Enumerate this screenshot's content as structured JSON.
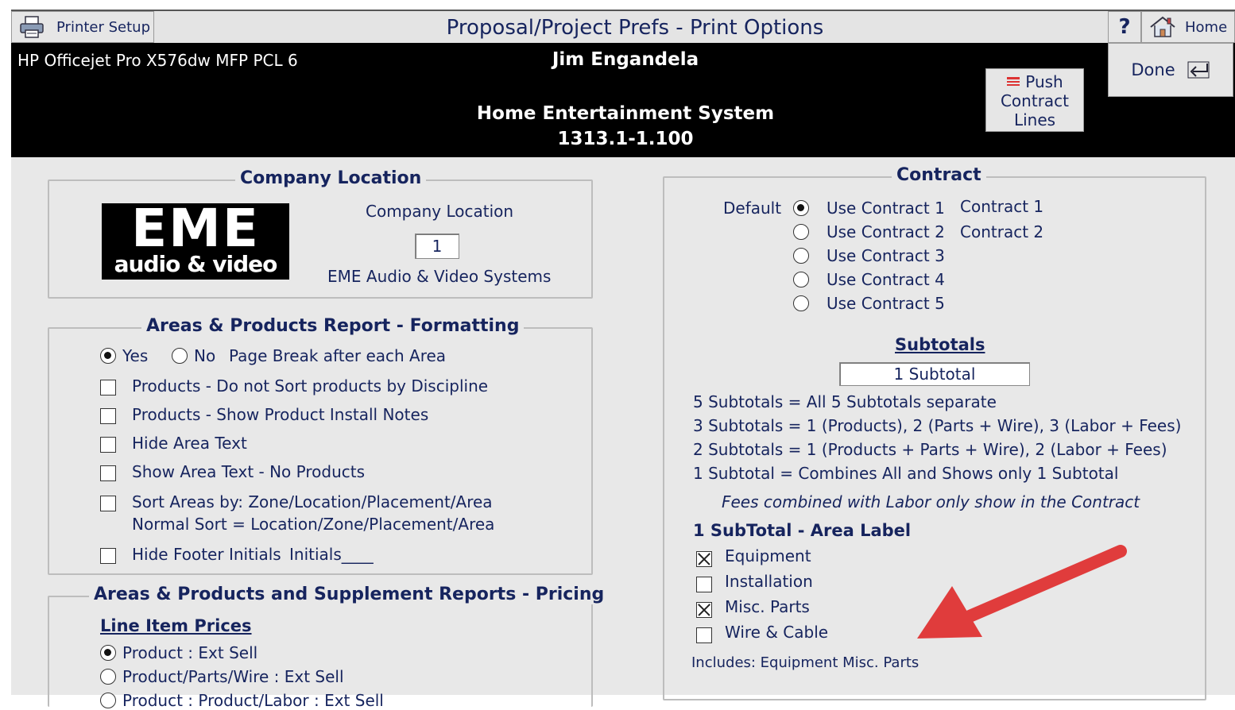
{
  "toolbar": {
    "printer_setup_label": "Printer Setup",
    "title": "Proposal/Project Prefs - Print Options",
    "help_label": "?",
    "home_label": "Home"
  },
  "header": {
    "printer_name": "HP Officejet Pro X576dw MFP PCL 6",
    "client_name": "Jim Engandela",
    "project_name": "Home Entertainment System",
    "project_number": "1313.1-1.100",
    "push_button_lines": [
      "Push",
      "Contract",
      "Lines"
    ],
    "done_label": "Done"
  },
  "company_location": {
    "legend": "Company Location",
    "logo_text_top": "EME",
    "logo_text_bottom": "audio & video",
    "field_label": "Company Location",
    "field_value": "1",
    "company_name": "EME Audio & Video Systems"
  },
  "formatting": {
    "legend": "Areas & Products Report - Formatting",
    "yes_label": "Yes",
    "no_label": "No",
    "page_break_label": "Page Break after each Area",
    "options": [
      {
        "label": "Products - Do not Sort products by Discipline",
        "checked": false
      },
      {
        "label": "Products - Show Product Install Notes",
        "checked": false
      },
      {
        "label": "Hide Area Text",
        "checked": false
      },
      {
        "label": "Show Area Text - No Products",
        "checked": false
      },
      {
        "label": "Sort Areas by: Zone/Location/Placement/Area",
        "checked": false
      },
      {
        "label": "Hide Footer Initials",
        "checked": false
      }
    ],
    "normal_sort_note": "Normal Sort = Location/Zone/Placement/Area",
    "initials_label": "Initials____"
  },
  "pricing": {
    "legend": "Areas & Products and Supplement Reports - Pricing",
    "line_item_heading": "Line Item Prices",
    "options": [
      {
        "label": "Product : Ext Sell",
        "selected": true
      },
      {
        "label": "Product/Parts/Wire : Ext Sell",
        "selected": false
      },
      {
        "label": "Product : Product/Labor : Ext Sell",
        "selected": false
      }
    ]
  },
  "contract": {
    "legend": "Contract",
    "default_label": "Default",
    "options": [
      {
        "label": "Use Contract 1",
        "name": "Contract 1",
        "selected": true
      },
      {
        "label": "Use Contract 2",
        "name": "Contract 2",
        "selected": false
      },
      {
        "label": "Use Contract 3",
        "name": "",
        "selected": false
      },
      {
        "label": "Use Contract 4",
        "name": "",
        "selected": false
      },
      {
        "label": "Use Contract 5",
        "name": "",
        "selected": false
      }
    ],
    "subtotals_heading": "Subtotals",
    "subtotal_value": "1 Subtotal",
    "subtotal_notes": [
      "5  Subtotals = All 5 Subtotals separate",
      "3  Subtotals = 1 (Products),  2 (Parts + Wire),  3 (Labor + Fees)",
      "2  Subtotals = 1 (Products + Parts + Wire),  2 (Labor + Fees)",
      "1  Subtotal   = Combines All and Shows only 1 Subtotal"
    ],
    "fees_note": "Fees combined with Labor only show in the Contract",
    "area_label_heading": "1 SubTotal - Area Label",
    "area_label_options": [
      {
        "label": "Equipment",
        "checked": true
      },
      {
        "label": "Installation",
        "checked": false
      },
      {
        "label": "Misc. Parts",
        "checked": true
      },
      {
        "label": "Wire & Cable",
        "checked": false
      }
    ],
    "includes_text": "Includes: Equipment  Misc. Parts"
  },
  "annotation": {
    "arrow_color": "#e03c3c"
  },
  "colors": {
    "text_navy": "#16245e",
    "panel_gray": "#e8e8e8",
    "header_black": "#000000"
  }
}
